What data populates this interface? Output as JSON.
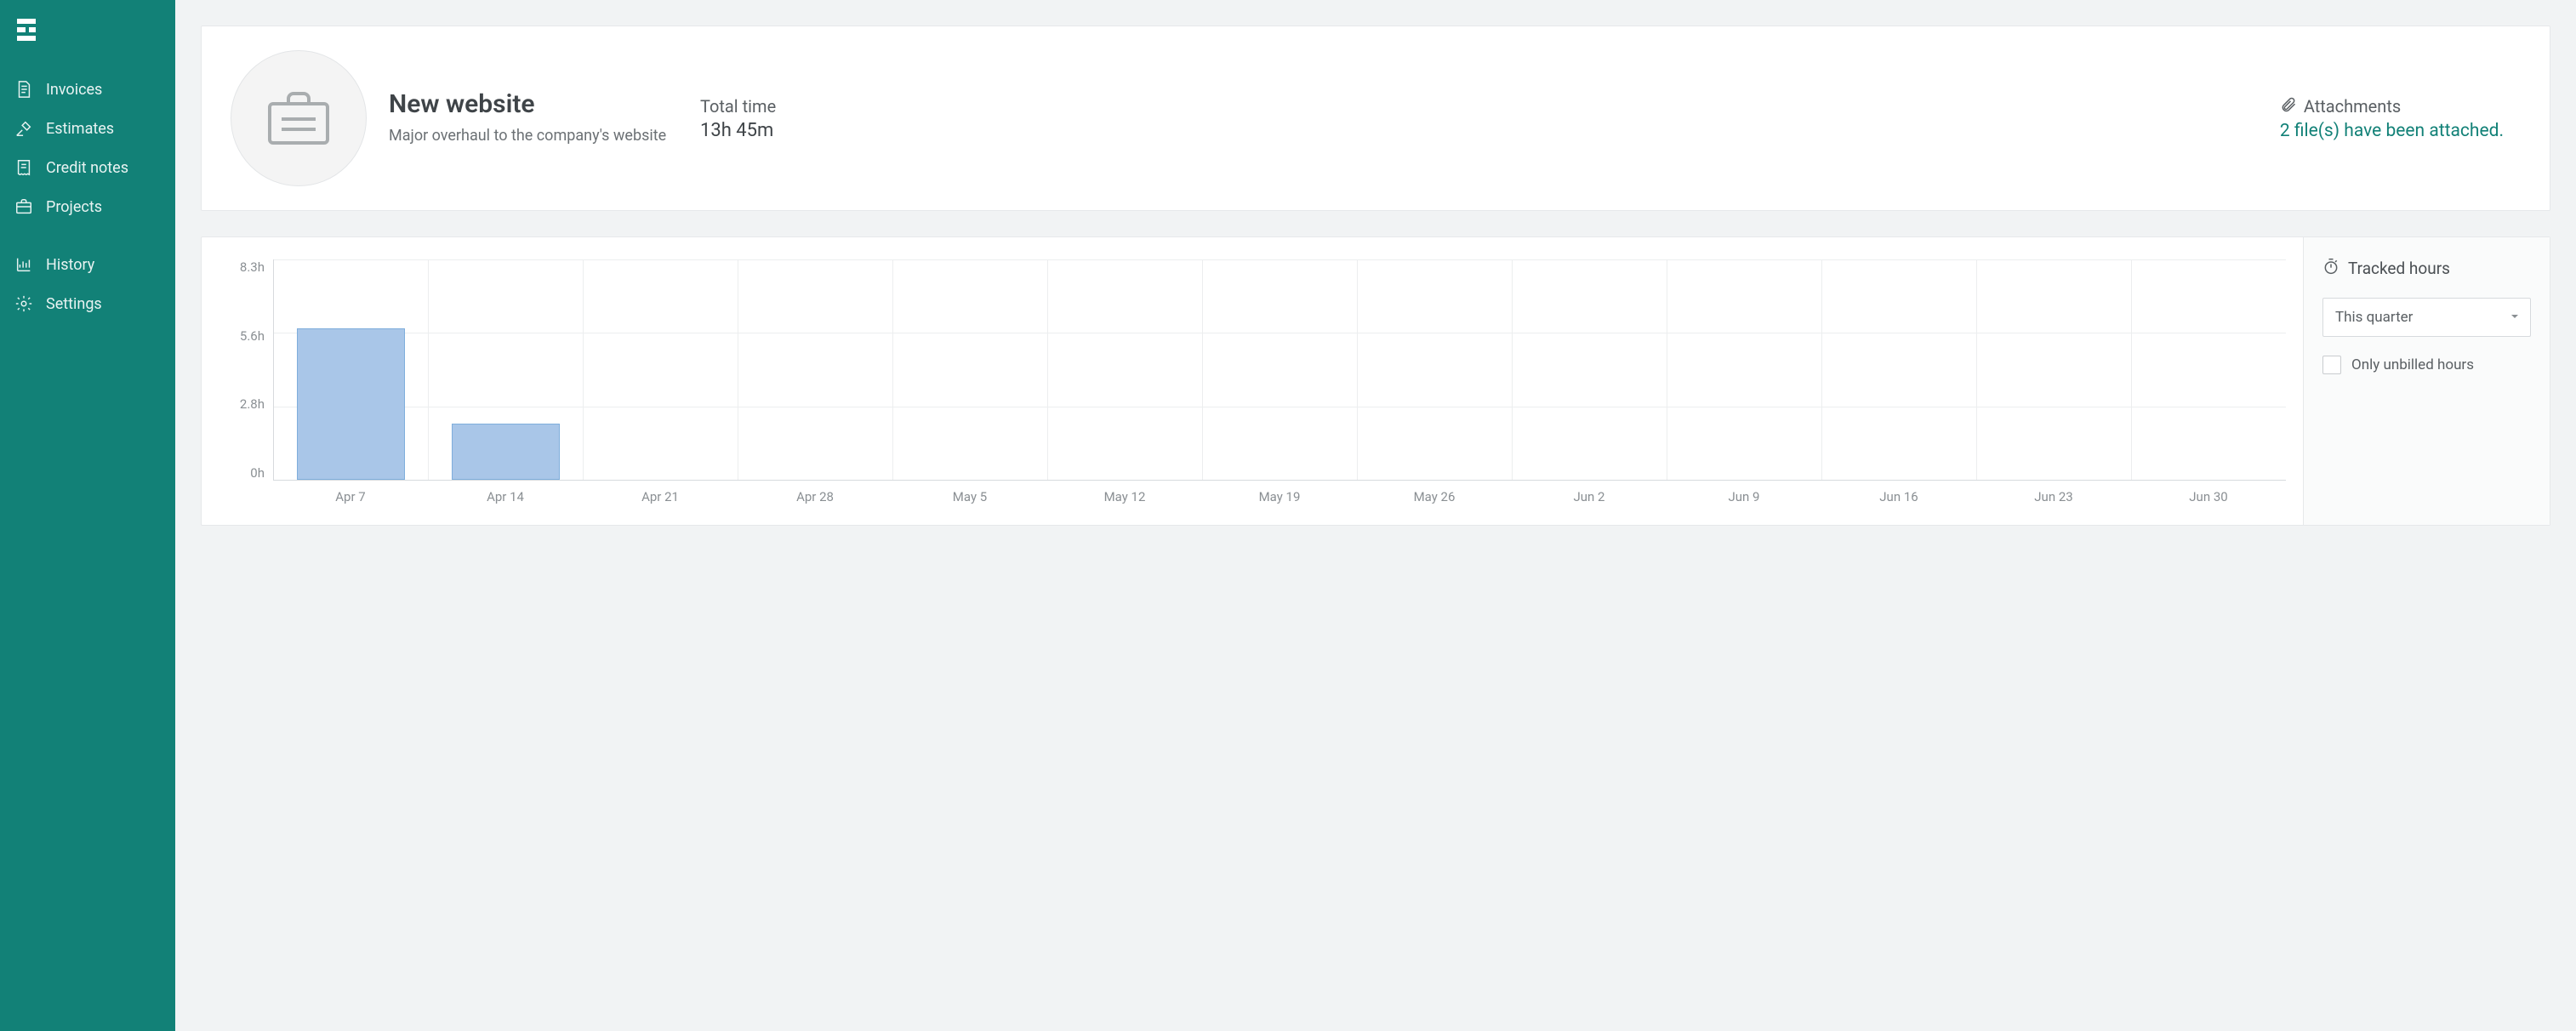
{
  "sidebar": {
    "items": [
      {
        "label": "Invoices"
      },
      {
        "label": "Estimates"
      },
      {
        "label": "Credit notes"
      },
      {
        "label": "Projects"
      },
      {
        "label": "History"
      },
      {
        "label": "Settings"
      }
    ]
  },
  "project": {
    "title": "New website",
    "subtitle": "Major overhaul to the company's website",
    "total_time_label": "Total time",
    "total_time_value": "13h 45m",
    "attachments_label": "Attachments",
    "attachments_link": "2 file(s) have been attached."
  },
  "chart_data": {
    "type": "bar",
    "title": "Tracked hours",
    "xlabel": "",
    "ylabel": "",
    "ylim": [
      0,
      8.3
    ],
    "y_ticks": [
      "8.3h",
      "5.6h",
      "2.8h",
      "0h"
    ],
    "categories": [
      "Apr 7",
      "Apr 14",
      "Apr 21",
      "Apr 28",
      "May 5",
      "May 12",
      "May 19",
      "May 26",
      "Jun 2",
      "Jun 9",
      "Jun 16",
      "Jun 23",
      "Jun 30"
    ],
    "values": [
      5.7,
      2.1,
      0,
      0,
      0,
      0,
      0,
      0,
      0,
      0,
      0,
      0,
      0
    ]
  },
  "controls": {
    "title": "Tracked hours",
    "range_selected": "This quarter",
    "checkbox_label": "Only unbilled hours",
    "checkbox_checked": false
  }
}
